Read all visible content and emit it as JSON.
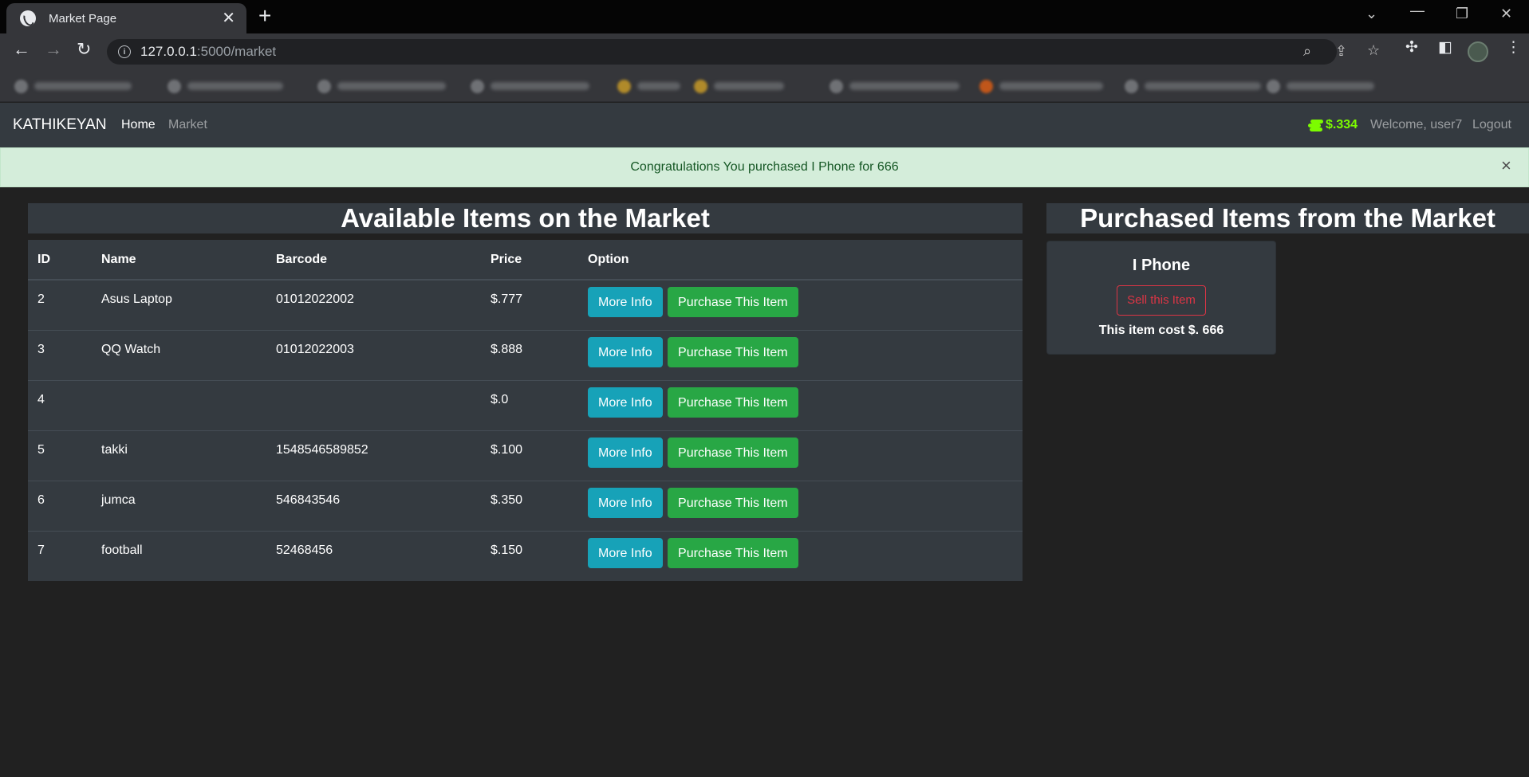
{
  "browser": {
    "tab_title": "Market Page",
    "tab_close": "✕",
    "new_tab": "+",
    "url_host": "127.0.0.1",
    "url_path": ":5000/market"
  },
  "navbar": {
    "brand": "KATHIKEYAN",
    "home": "Home",
    "market": "Market",
    "budget": "$.334",
    "welcome": "Welcome, user7",
    "logout": "Logout",
    "budget_color": "#7cfc00"
  },
  "alert": {
    "message": "Congratulations You purchased I Phone for 666",
    "close": "×"
  },
  "market": {
    "title": "Available Items on the Market",
    "columns": [
      "ID",
      "Name",
      "Barcode",
      "Price",
      "Option"
    ],
    "rows": [
      {
        "id": "2",
        "name": "Asus Laptop",
        "barcode": "01012022002",
        "price": "$.777"
      },
      {
        "id": "3",
        "name": "QQ Watch",
        "barcode": "01012022003",
        "price": "$.888"
      },
      {
        "id": "4",
        "name": "",
        "barcode": "",
        "price": "$.0"
      },
      {
        "id": "5",
        "name": "takki",
        "barcode": "1548546589852",
        "price": "$.100"
      },
      {
        "id": "6",
        "name": "jumca",
        "barcode": "546843546",
        "price": "$.350"
      },
      {
        "id": "7",
        "name": "football",
        "barcode": "52468456",
        "price": "$.150"
      }
    ],
    "more_info_label": "More Info",
    "purchase_label": "Purchase This Item"
  },
  "owned": {
    "title": "Purchased Items from the Market",
    "item_name": "I Phone",
    "sell_label": "Sell this Item",
    "cost_text": "This item cost $. 666"
  },
  "colors": {
    "navbar_bg": "#343a40",
    "alert_bg": "#d4edda",
    "info": "#17a2b8",
    "success": "#28a745",
    "danger": "#dc3545"
  }
}
